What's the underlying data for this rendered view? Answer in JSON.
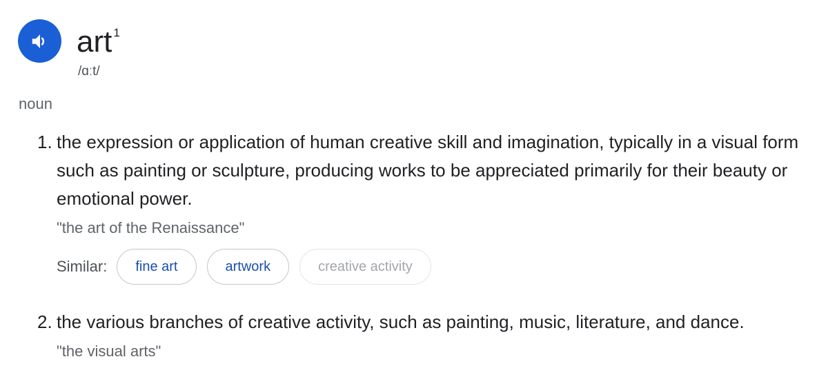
{
  "entry": {
    "word": "art",
    "superscript": "1",
    "phonetic": "/ɑːt/",
    "audio_icon": "speaker-icon",
    "part_of_speech": "noun"
  },
  "senses": [
    {
      "number": "1.",
      "definition": "the expression or application of human creative skill and imagination, typically in a visual form such as painting or sculpture, producing works to be appreciated primarily for their beauty or emotional power.",
      "example": "\"the art of the Renaissance\"",
      "similar_label": "Similar:",
      "similar": [
        "fine art",
        "artwork",
        "creative activity"
      ]
    },
    {
      "number": "2.",
      "definition": "the various branches of creative activity, such as painting, music, literature, and dance.",
      "example": "\"the visual arts\""
    }
  ],
  "colors": {
    "accent": "#1a5fd6",
    "link": "#1a4fad",
    "muted": "#5f6368"
  }
}
